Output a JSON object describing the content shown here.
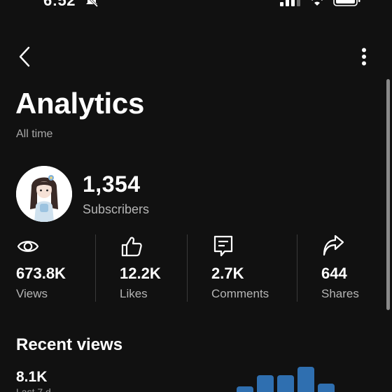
{
  "status_bar": {
    "time": "6:52"
  },
  "header": {
    "title": "Analytics",
    "period": "All time"
  },
  "profile": {
    "subscribers_count": "1,354",
    "subscribers_label": "Subscribers"
  },
  "stats": [
    {
      "icon": "eye-icon",
      "value": "673.8K",
      "label": "Views"
    },
    {
      "icon": "thumbs-up-icon",
      "value": "12.2K",
      "label": "Likes"
    },
    {
      "icon": "comment-icon",
      "value": "2.7K",
      "label": "Comments"
    },
    {
      "icon": "share-icon",
      "value": "644",
      "label": "Shares"
    }
  ],
  "recent_views": {
    "title": "Recent views",
    "value": "8.1K",
    "sub": "Last 7 d"
  },
  "chart_data": {
    "type": "bar",
    "values": [
      2,
      6,
      6,
      9,
      3
    ],
    "bar_color": "#2f6fb0"
  },
  "colors": {
    "background": "#111111",
    "text": "#ffffff",
    "muted": "#b5b5b5",
    "accent_bar": "#2f6fb0"
  }
}
